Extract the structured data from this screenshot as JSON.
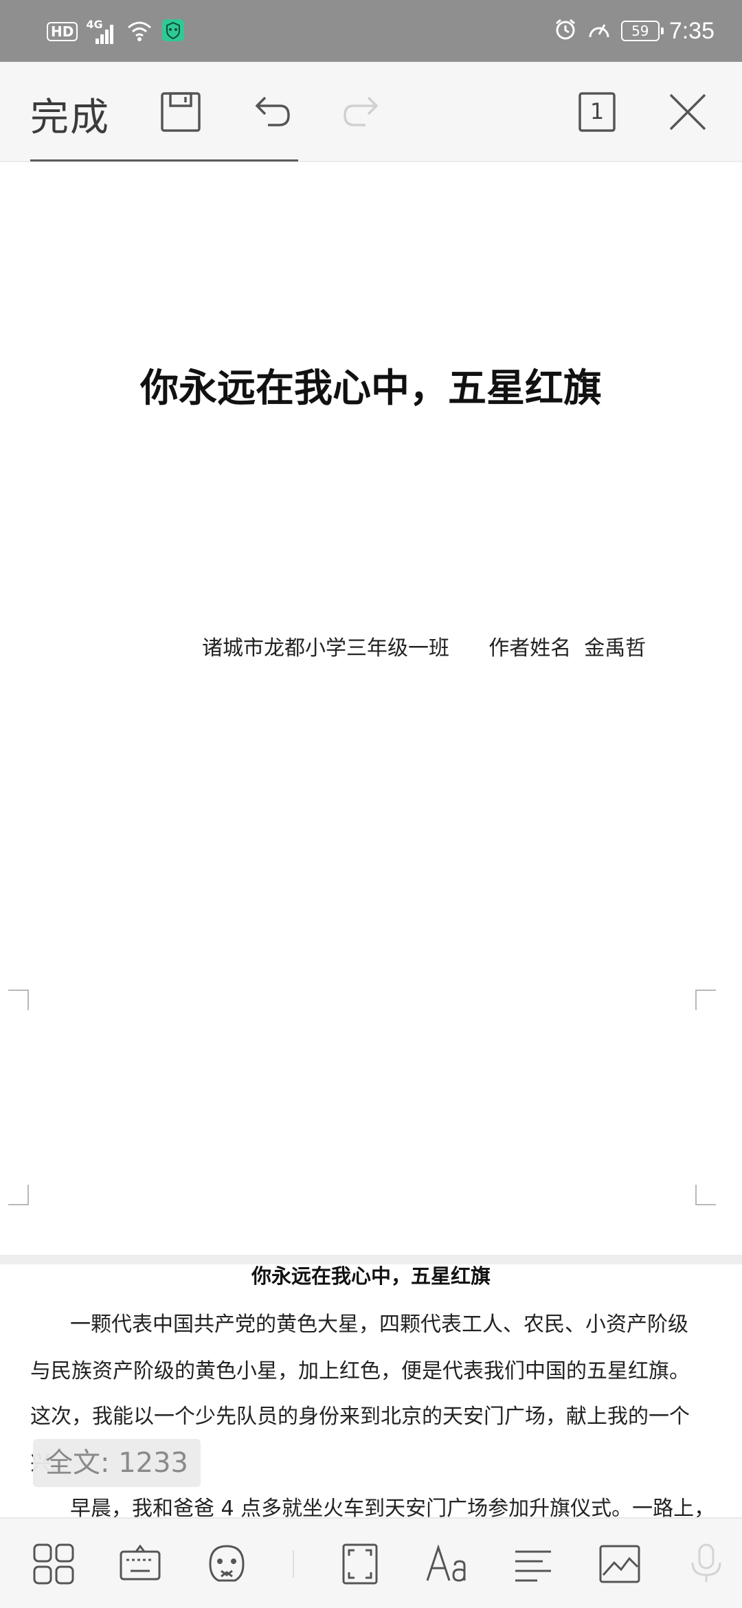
{
  "status_bar": {
    "hd_label": "HD",
    "network_label": "4G",
    "battery_level": "59",
    "time": "7:35"
  },
  "toolbar": {
    "done_label": "完成",
    "page_indicator": "1",
    "icons": [
      "save-icon",
      "undo-icon",
      "redo-icon",
      "page-count-icon",
      "close-icon"
    ]
  },
  "document": {
    "page1": {
      "title": "你永远在我心中，五星红旗",
      "author_line": "诸城市龙都小学三年级一班      作者姓名  金禹哲"
    },
    "page2": {
      "title": "你永远在我心中，五星红旗",
      "lines": [
        "一颗代表中国共产党的黄色大星，四颗代表工人、农民、小资产阶级",
        "与民族资产阶级的黄色小星，加上红色，便是代表我们中国的五星红旗。",
        "这次，我能以一个少先队员的身份来到北京的天安门广场，献上我的一个",
        "           兴。",
        "早晨，我和爸爸 4 点多就坐火车到天安门广场参加升旗仪式。一路上，"
      ]
    }
  },
  "word_count": {
    "label": "全文: 1233"
  },
  "bottom_toolbar": {
    "icons": [
      "apps-icon",
      "keyboard-icon",
      "sticker-icon",
      "fullscreen-icon",
      "font-icon",
      "paragraph-icon",
      "image-icon",
      "microphone-icon"
    ]
  }
}
